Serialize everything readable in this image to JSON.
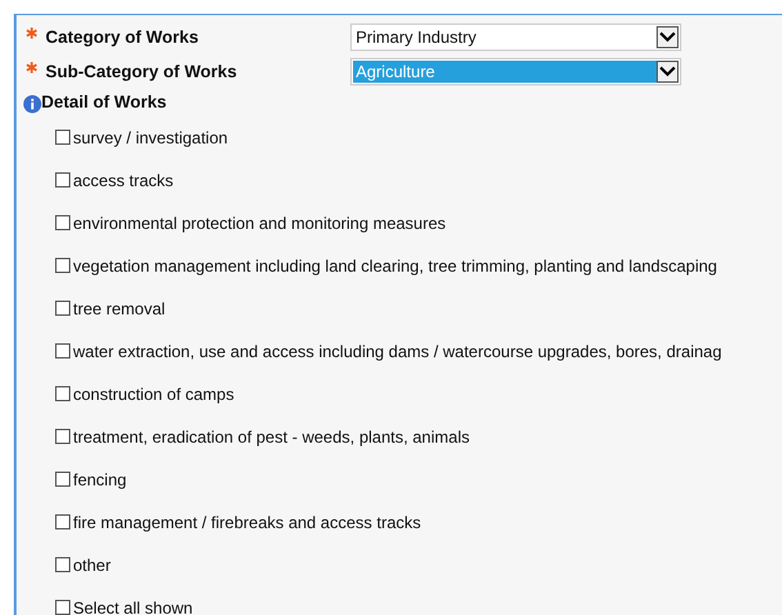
{
  "fields": [
    {
      "label": "Category of Works",
      "required": true,
      "value": "Primary Industry",
      "highlighted": false
    },
    {
      "label": "Sub-Category of Works",
      "required": true,
      "value": "Agriculture",
      "highlighted": true
    }
  ],
  "detail": {
    "label": "Detail of Works",
    "options": [
      {
        "label": "survey / investigation",
        "checked": false
      },
      {
        "label": "access tracks",
        "checked": false
      },
      {
        "label": "environmental protection and monitoring measures",
        "checked": false
      },
      {
        "label": "vegetation management including land clearing, tree trimming, planting and landscaping",
        "checked": false
      },
      {
        "label": "tree removal",
        "checked": false
      },
      {
        "label": "water extraction, use and access including dams / watercourse upgrades, bores, drainag",
        "checked": false
      },
      {
        "label": "construction of camps",
        "checked": false
      },
      {
        "label": "treatment, eradication of pest - weeds, plants, animals",
        "checked": false
      },
      {
        "label": "fencing",
        "checked": false
      },
      {
        "label": "fire management / firebreaks and access tracks",
        "checked": false
      },
      {
        "label": "other",
        "checked": false
      },
      {
        "label": "Select all shown",
        "checked": false
      }
    ]
  }
}
